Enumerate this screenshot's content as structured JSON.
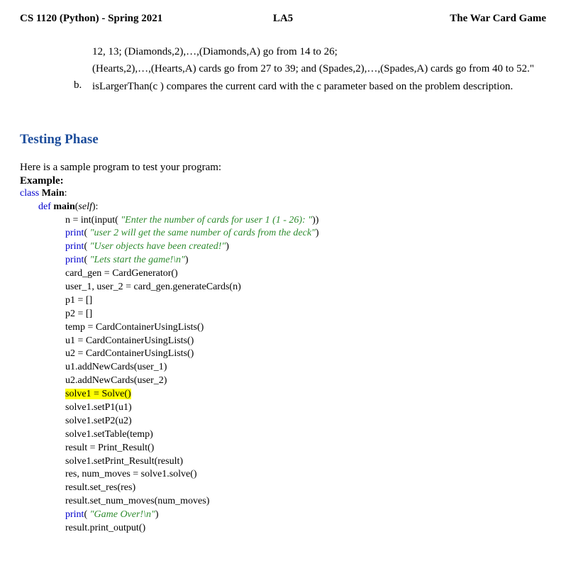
{
  "header": {
    "left": "CS 1120 (Python) - Spring 2021",
    "center": "LA5",
    "right": "The War Card Game"
  },
  "list": {
    "cont_line1": "12, 13; (Diamonds,2),…,(Diamonds,A) go from 14 to 26;",
    "cont_line2": "(Hearts,2),…,(Hearts,A) cards go from 27 to 39; and (Spades,2),…,(Spades,A) cards go from 40 to 52.\"",
    "b_marker": "b.",
    "b_text": "isLargerThan(c ) compares the current card with the c parameter based on the problem description."
  },
  "section_title": "Testing Phase",
  "intro": "Here is a sample program to test your program:",
  "example_label": "Example:",
  "code": {
    "kw_class": "class",
    "cls_main": "Main",
    "colon": ":",
    "kw_def": "def",
    "fn_main": "main",
    "open_paren": "(",
    "self": "self",
    "close_paren_colon": "):",
    "l3": "n = int(input(",
    "s3": "\"Enter the number of cards for user 1 (1 - 26): \"",
    "l3_end": "))",
    "kw_print": "print",
    "s4": "\"user 2 will get the same number of cards from the deck\"",
    "s5": "\"User objects have been created!\"",
    "s6": "\"Lets start the game!\\n\"",
    "l7": "card_gen = CardGenerator()",
    "l8": "user_1, user_2 = card_gen.generateCards(n)",
    "l9": "p1 = []",
    "l10": "p2 = []",
    "l11": "temp = CardContainerUsingLists()",
    "l12": "u1 = CardContainerUsingLists()",
    "l13": "u2 = CardContainerUsingLists()",
    "l14": "u1.addNewCards(user_1)",
    "l15": "u2.addNewCards(user_2)",
    "l16": "solve1 = Solve()",
    "l17": "solve1.setP1(u1)",
    "l18": "solve1.setP2(u2)",
    "l19": "solve1.setTable(temp)",
    "l20": "result = Print_Result()",
    "l21": "solve1.setPrint_Result(result)",
    "l22": "res, num_moves = solve1.solve()",
    "l23": "result.set_res(res)",
    "l24": "result.set_num_moves(num_moves)",
    "s25": "\"Game Over!\\n\"",
    "l26": "result.print_output()"
  }
}
